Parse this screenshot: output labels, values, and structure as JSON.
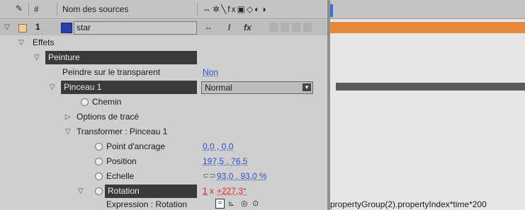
{
  "header": {
    "number_col": "#",
    "source_col": "Nom des sources",
    "switch_icons": "⇔✲╲fx▣◇◐◑"
  },
  "layer": {
    "number": "1",
    "name": "star",
    "sw1": "⇔",
    "sw2": "/",
    "sw3": "fx"
  },
  "rows": {
    "effets": "Effets",
    "peinture": "Peinture",
    "peindre_label": "Peindre sur le transparent",
    "peindre_value": "Non",
    "pinceau_label": "Pinceau 1",
    "pinceau_mode": "Normal",
    "chemin": "Chemin",
    "options": "Options de tracé",
    "transformer": "Transformer : Pinceau 1",
    "ancrage_label": "Point d'ancrage",
    "ancrage_value": "0,0 , 0,0",
    "position_label": "Position",
    "position_value": "197,5 , 76,5",
    "echelle_label": "Echelle",
    "echelle_value": "93,0 , 93,0 %",
    "rotation_label": "Rotation",
    "rotation_value_prefix": "1",
    "rotation_value_x": "x",
    "rotation_value": "+227,3°",
    "expression_label": "Expression : Rotation",
    "expression_code": "propertyGroup(2).propertyIndex*time*200"
  },
  "colors": {
    "layer_bar": "#e38a3c",
    "paint_bar": "#5a5a5a",
    "value_blue": "#2f52c4",
    "rotation_red": "#d8262b"
  }
}
